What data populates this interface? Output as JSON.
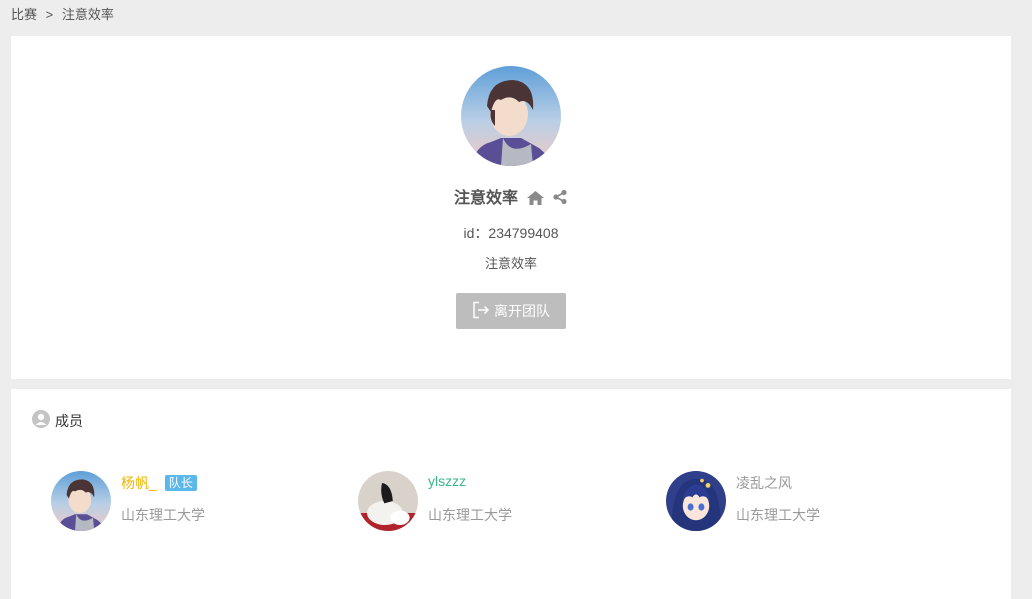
{
  "breadcrumb": {
    "root": "比赛",
    "separator": ">",
    "current": "注意效率"
  },
  "team": {
    "name": "注意效率",
    "id_label": "id：",
    "id_value": "234799408",
    "description": "注意效率",
    "leave_label": "离开团队",
    "icons": [
      "home-icon",
      "share-icon",
      "exit-icon"
    ]
  },
  "members_section": {
    "title": "成员",
    "icon": "user-circle-icon",
    "members": [
      {
        "name": "杨帆_",
        "badge": "队长",
        "school": "山东理工大学",
        "name_color": "#f0b400"
      },
      {
        "name": "ylszzz",
        "school": "山东理工大学",
        "name_color": "#3bb38b"
      },
      {
        "name": "凌乱之风",
        "school": "山东理工大学",
        "name_color": "#999999"
      }
    ]
  },
  "colors": {
    "background": "#ededed",
    "card": "#ffffff",
    "leave_button": "#bdbdbd",
    "badge": "#5bb8ea"
  }
}
